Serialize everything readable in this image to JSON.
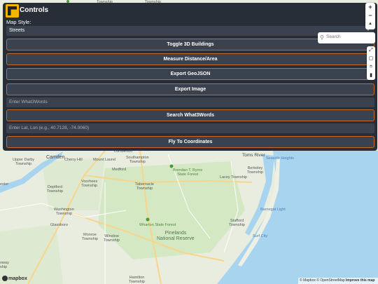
{
  "panel": {
    "title": "Controls",
    "map_style_label": "Map Style:",
    "map_style_value": "Streets",
    "buttons": {
      "toggle_3d": "Toggle 3D Buildings",
      "measure": "Measure Distance/Area",
      "export_geojson": "Export GeoJSON",
      "export_image": "Export Image",
      "search_w3w": "Search What3Words",
      "fly_to": "Fly To Coordinates"
    },
    "inputs": {
      "w3w_placeholder": "Enter What3Words",
      "latlon_placeholder": "Enter Lat, Lon (e.g., 40.7128, -74.0060)"
    },
    "accent_color": "#c66a2b",
    "panel_color": "#1e2530"
  },
  "map_controls": {
    "zoom_in": "+",
    "zoom_out": "−",
    "compass": "▲",
    "search_placeholder": "Search",
    "draw_tools": [
      "line-tool-icon",
      "polygon-tool-icon",
      "marker-tool-icon",
      "trash-icon"
    ]
  },
  "map_labels": {
    "township_top1": "Township",
    "township_top2": "Township",
    "camden": "Camden",
    "cherry_hill": "Cherry Hill",
    "mount_laurel": "Mount Laurel",
    "medford": "Medford",
    "southampton": "Southampton\nTownship",
    "upper_darby": "Upper Darby\nTownship",
    "voorhees": "Voorhees\nTownship",
    "deptford": "Deptford\nTownship",
    "washington": "Washington\nTownship",
    "glassboro": "Glassboro",
    "monroe": "Monroe\nTownship",
    "winslow": "Winslow\nTownship",
    "tabernacle": "Tabernacle\nTownship",
    "brendan": "Brendan T. Byrne\nState Forest",
    "wharton": "Wharton State Forest",
    "pinelands": "Pinelands\nNational Reserve",
    "toms_river": "Toms River",
    "seaside": "Seaside Heights",
    "berkeley": "Berkeley\nTownship",
    "lacey": "Lacey Township",
    "barnegat": "Barnegat Light",
    "stafford": "Stafford\nTownship",
    "surf_city": "Surf City",
    "hamilton": "Hamilton\nTownship",
    "chester": "ester",
    "way": "oway\nship",
    "lumberton": "Lumberton"
  },
  "footer": {
    "logo": "mapbox",
    "attribution_1": "© Mapbox © OpenStreetMap",
    "attribution_2": "Improve this map"
  }
}
